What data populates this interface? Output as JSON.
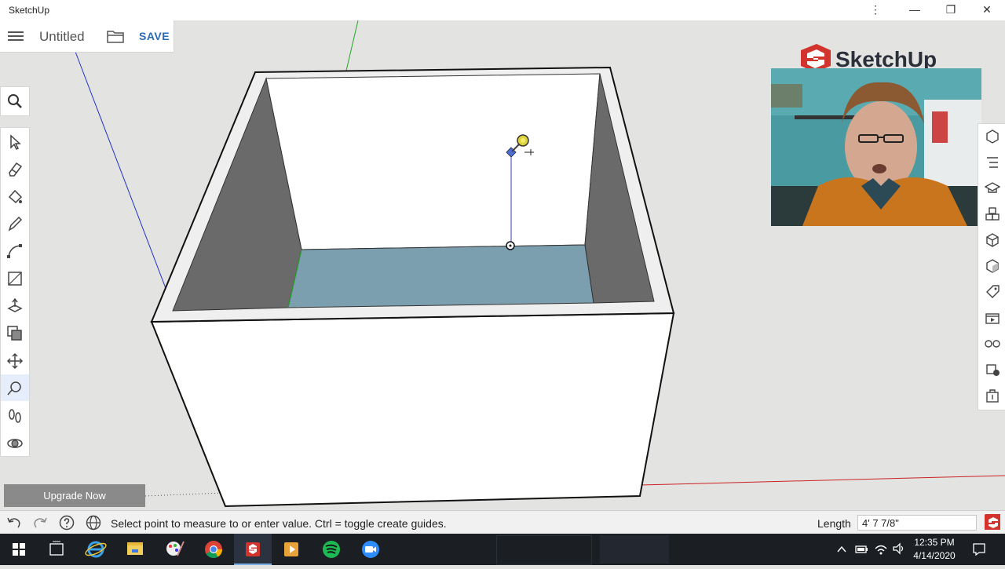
{
  "window": {
    "title": "SketchUp",
    "more_glyph": "⋮",
    "minimize_glyph": "—",
    "restore_glyph": "❐",
    "close_glyph": "✕"
  },
  "file": {
    "doc_title": "Untitled",
    "save_label": "SAVE"
  },
  "logo": {
    "text": "SketchUp"
  },
  "left_tools": [
    "select-tool",
    "eraser-tool",
    "paint-bucket-tool",
    "pencil-tool",
    "arc-tool",
    "shape-tool",
    "push-pull-tool",
    "offset-tool",
    "move-tool",
    "tape-measure-tool",
    "walk-tool",
    "orbit-tool"
  ],
  "right_panels": [
    "entity-info-icon",
    "outliner-icon",
    "instructor-icon",
    "components-icon",
    "materials-icon",
    "styles-icon",
    "tags-icon",
    "scenes-icon",
    "display-icon",
    "shadows-icon",
    "solid-inspector-icon"
  ],
  "upgrade": {
    "label": "Upgrade Now"
  },
  "status": {
    "text": "Select point to measure to or enter value. Ctrl = toggle create guides.",
    "length_label": "Length",
    "length_value": "4' 7 7/8\""
  },
  "taskbar": {
    "time": "12:35 PM",
    "date": "4/14/2020"
  },
  "colors": {
    "accent": "#2a6bb5",
    "floor": "#7c9fb0",
    "inner_wall": "#6a6a6a",
    "logo_red": "#d2332c"
  }
}
